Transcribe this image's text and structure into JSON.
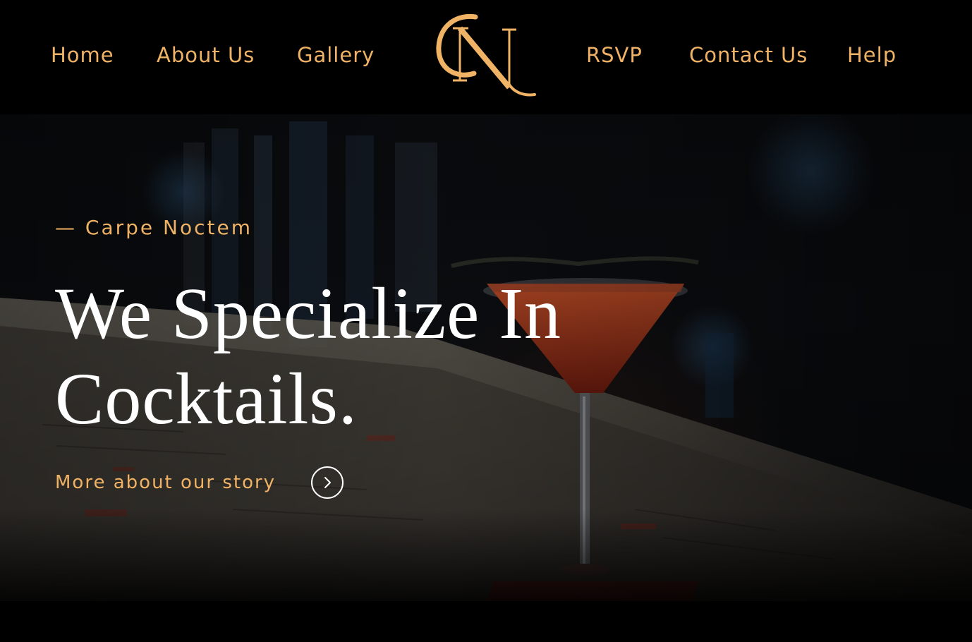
{
  "nav": {
    "left": [
      {
        "id": "home",
        "label": "Home"
      },
      {
        "id": "about",
        "label": "About Us"
      },
      {
        "id": "gallery",
        "label": "Gallery"
      }
    ],
    "right": [
      {
        "id": "rsvp",
        "label": "RSVP"
      },
      {
        "id": "contact",
        "label": "Contact Us"
      },
      {
        "id": "help",
        "label": "Help"
      }
    ],
    "logo": {
      "letters": "CN",
      "icon": "cn-monogram-logo"
    }
  },
  "hero": {
    "tagline": "— Carpe Noctem",
    "headline_line1": "We Specialize In",
    "headline_line2": "Cocktails.",
    "story_link": "More about our story",
    "story_icon": "chevron-right-circle-icon"
  },
  "colors": {
    "accent": "#f0b264",
    "background": "#000000",
    "headline": "#ffffff"
  }
}
